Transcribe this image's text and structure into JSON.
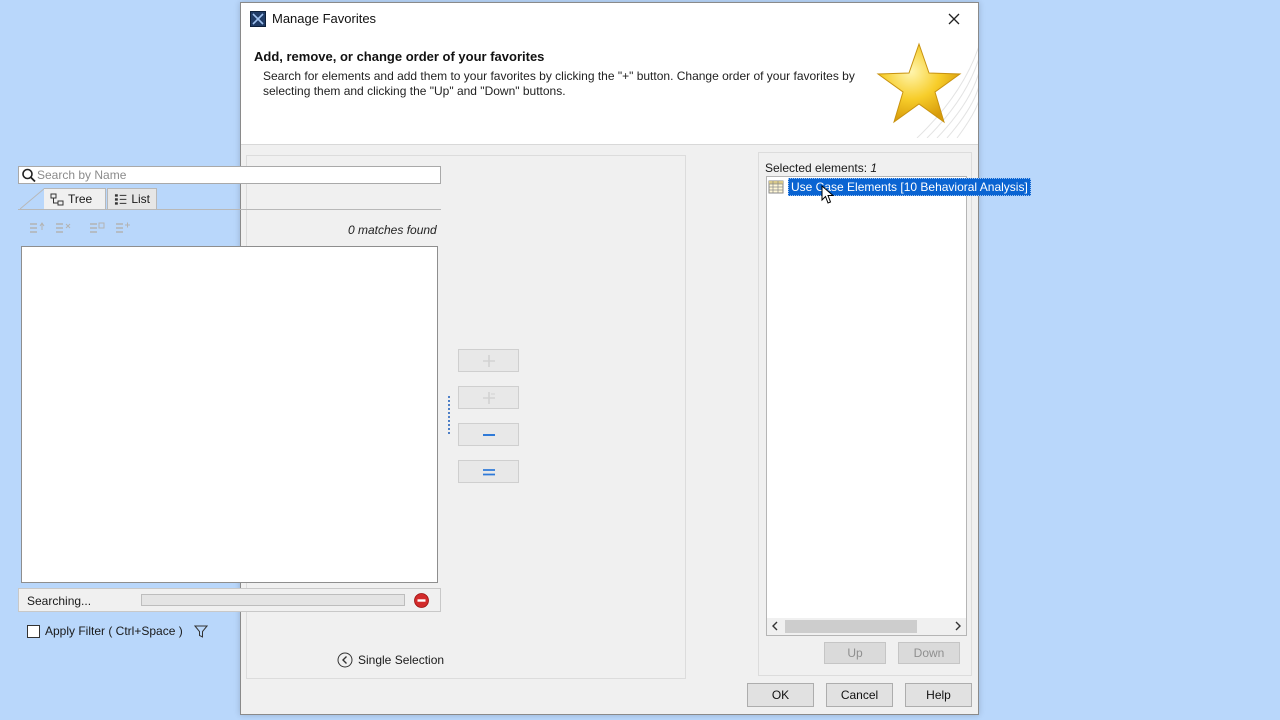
{
  "window": {
    "title": "Manage Favorites"
  },
  "header": {
    "title": "Add, remove, or change order of your favorites",
    "description": "Search for elements and add them to your favorites by clicking the \"+\" button. Change order of your favorites by selecting them and clicking the \"Up\" and \"Down\" buttons."
  },
  "search": {
    "placeholder": "Search by Name",
    "value": ""
  },
  "tabs": [
    {
      "label": "Tree"
    },
    {
      "label": "List"
    }
  ],
  "results": {
    "matches": "0 matches found"
  },
  "status": {
    "label": "Searching..."
  },
  "filter": {
    "label": "Apply Filter ( Ctrl+Space )",
    "checked": false
  },
  "single_selection": {
    "label": "Single Selection"
  },
  "selected": {
    "label": "Selected elements:",
    "count": "1",
    "items": [
      {
        "label": "Use Case Elements [10 Behavioral Analysis]"
      }
    ]
  },
  "order_buttons": {
    "up": "Up",
    "down": "Down"
  },
  "buttons": {
    "ok": "OK",
    "cancel": "Cancel",
    "help": "Help"
  },
  "colors": {
    "selection": "#0a64d2",
    "desktop": "#b9d7fb",
    "stop": "#d22b2b",
    "star": "#f5c518"
  }
}
